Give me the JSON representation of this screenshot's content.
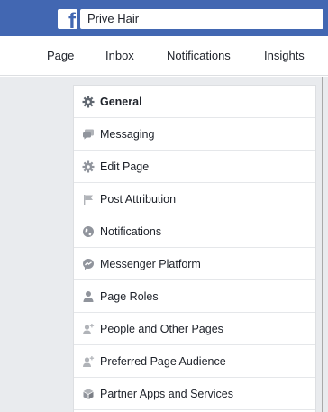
{
  "header": {
    "page_name": "Prive Hair",
    "logo_icon": "facebook-logo-icon",
    "brand_color": "#4267b2"
  },
  "nav": {
    "page": "Page",
    "inbox": "Inbox",
    "notifications": "Notifications",
    "insights": "Insights"
  },
  "settings_menu": {
    "items": [
      {
        "label": "General",
        "icon": "gear-icon",
        "active": true
      },
      {
        "label": "Messaging",
        "icon": "chat-bubbles-icon"
      },
      {
        "label": "Edit Page",
        "icon": "gear-icon"
      },
      {
        "label": "Post Attribution",
        "icon": "flag-icon"
      },
      {
        "label": "Notifications",
        "icon": "globe-icon"
      },
      {
        "label": "Messenger Platform",
        "icon": "messenger-icon"
      },
      {
        "label": "Page Roles",
        "icon": "person-icon"
      },
      {
        "label": "People and Other Pages",
        "icon": "add-person-icon"
      },
      {
        "label": "Preferred Page Audience",
        "icon": "add-person-icon"
      },
      {
        "label": "Partner Apps and Services",
        "icon": "cube-icon"
      }
    ]
  }
}
